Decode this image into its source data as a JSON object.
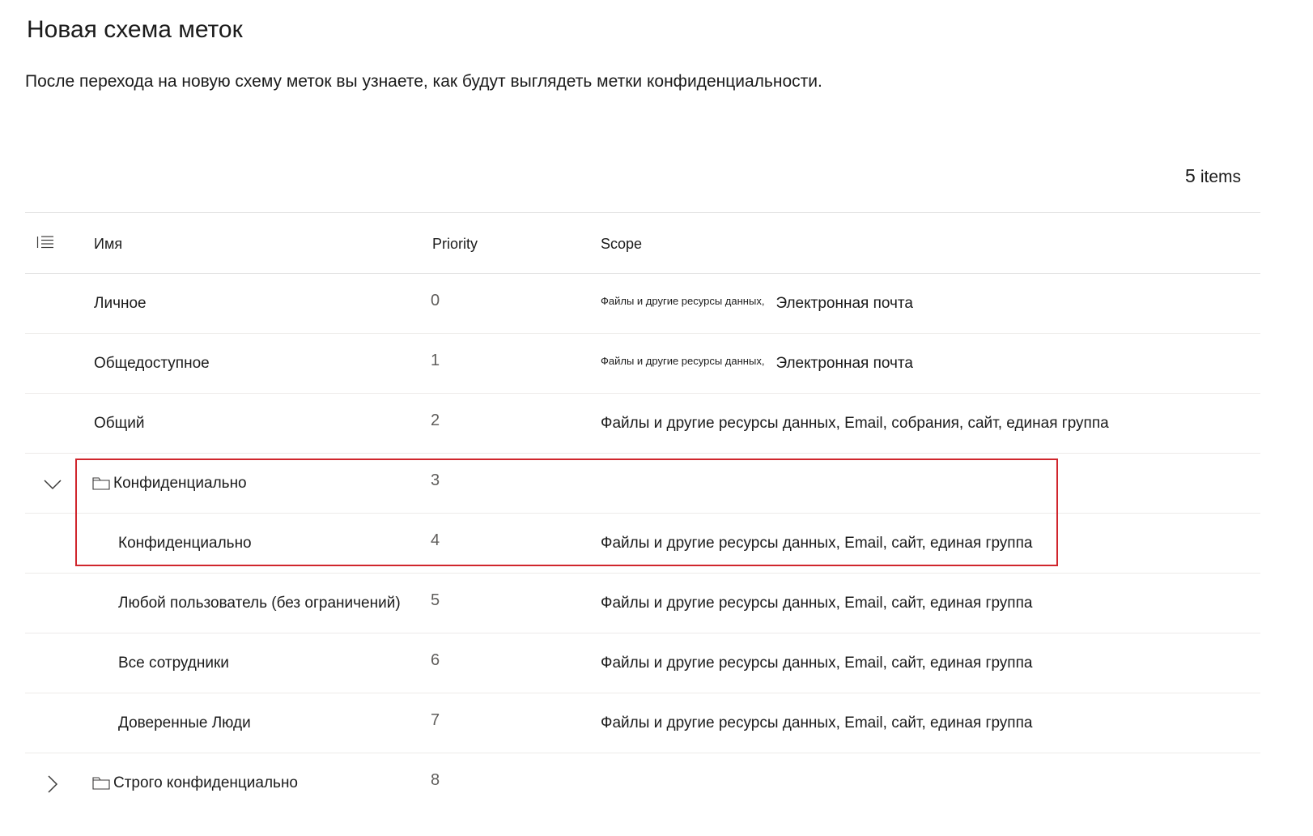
{
  "page": {
    "title": "Новая схема меток",
    "description": "После перехода на новую схему меток вы узнаете, как будут выглядеть метки конфиденциальности.",
    "items_count": "5",
    "items_label": "items"
  },
  "table": {
    "headers": {
      "name": "Имя",
      "priority": "Priority",
      "scope": "Scope"
    },
    "rows": [
      {
        "name": "Личное",
        "priority": "0",
        "scope_small": "Файлы и другие ресурсы данных,",
        "scope": "Электронная почта"
      },
      {
        "name": "Общедоступное",
        "priority": "1",
        "scope_small": "Файлы и другие ресурсы данных,",
        "scope": "Электронная почта"
      },
      {
        "name": "Общий",
        "priority": "2",
        "scope": "Файлы и другие ресурсы данных, Email, собрания, сайт, единая группа"
      },
      {
        "name": "Конфиденциально",
        "priority": "3",
        "scope": ""
      },
      {
        "name": "Конфиденциально",
        "priority": "4",
        "scope": "Файлы и другие ресурсы данных, Email, сайт, единая группа"
      },
      {
        "name": "Любой пользователь (без ограничений)",
        "priority": "5",
        "scope": "Файлы и другие ресурсы данных, Email, сайт, единая группа"
      },
      {
        "name": "Все сотрудники",
        "priority": "6",
        "scope": "Файлы и другие ресурсы данных, Email, сайт, единая группа"
      },
      {
        "name": "Доверенные Люди",
        "priority": "7",
        "scope": "Файлы и другие ресурсы данных, Email, сайт, единая группа"
      },
      {
        "name": "Строго конфиденциально",
        "priority": "8",
        "scope": ""
      }
    ]
  },
  "colors": {
    "highlight": "#d0262d",
    "divider": "#edebe9",
    "text": "#1b1b1b",
    "muted": "#605e5c"
  },
  "icons": {
    "columns": "list-icon",
    "folder": "folder-icon",
    "expanded": "chevron-down-icon",
    "collapsed": "chevron-right-icon"
  }
}
